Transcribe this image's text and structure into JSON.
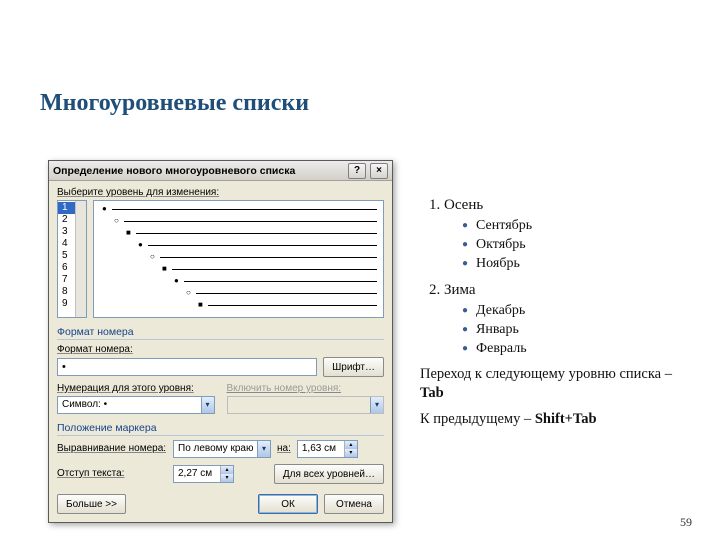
{
  "title": "Многоуровневые списки",
  "page_number": "59",
  "dialog": {
    "title": "Определение нового многоуровневого списка",
    "help_btn": "?",
    "close_btn": "×",
    "select_level_label": "Выберите уровень для изменения:",
    "levels": [
      "1",
      "2",
      "3",
      "4",
      "5",
      "6",
      "7",
      "8",
      "9"
    ],
    "section_format": "Формат номера",
    "format_label": "Формат номера:",
    "format_value": "•",
    "font_btn": "Шрифт…",
    "numbering_label": "Нумерация для этого уровня:",
    "include_level_label": "Включить номер уровня:",
    "symbol_label": "Символ:",
    "symbol_value": "•",
    "section_position": "Положение маркера",
    "align_label": "Выравнивание номера:",
    "align_value": "По левому краю",
    "at_label": "на:",
    "at_value": "1,63 см",
    "indent_label": "Отступ текста:",
    "indent_value": "2,27 см",
    "all_levels_btn": "Для всех уровней…",
    "more_btn": "Больше >>",
    "ok_btn": "ОК",
    "cancel_btn": "Отмена"
  },
  "content": {
    "item1": "Осень",
    "item1a": "Сентябрь",
    "item1b": "Октябрь",
    "item1c": "Ноябрь",
    "item2": "Зима",
    "item2a": "Декабрь",
    "item2b": "Январь",
    "item2c": "Февраль",
    "note1_pre": "Переход к следующему уровню списка – ",
    "note1_key": "Tab",
    "note2_pre": "К предыдущему – ",
    "note2_key": "Shift+Tab"
  }
}
